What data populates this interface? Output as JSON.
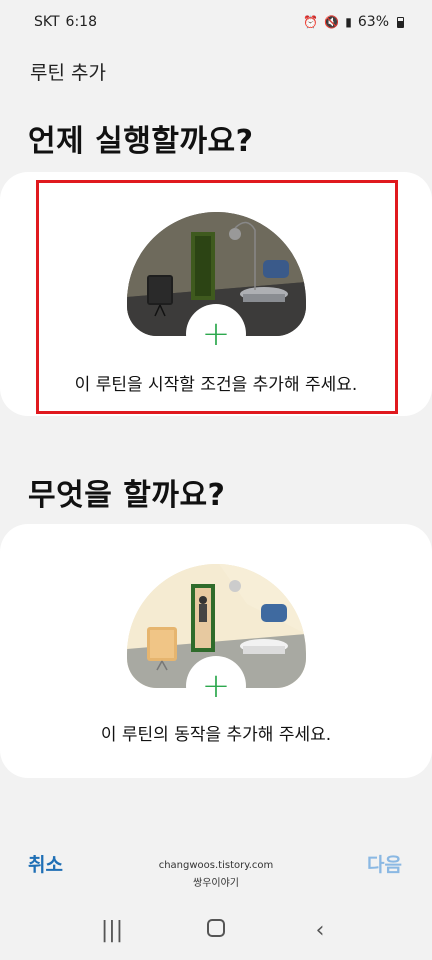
{
  "status_bar": {
    "carrier": "SKT",
    "time": "6:18",
    "battery": "63%",
    "icons": [
      "alarm-icon",
      "mute-icon",
      "volte-icon",
      "signal-icon",
      "battery-icon"
    ]
  },
  "screen_title": "루틴 추가",
  "when_section": {
    "heading": "언제 실행할까요?",
    "prompt": "이 루틴을 시작할 조건을 추가해 주세요.",
    "highlight_color": "#e0191e"
  },
  "what_section": {
    "heading": "무엇을 할까요?",
    "prompt": "이 루틴의 동작을 추가해 주세요."
  },
  "plus_symbol": "+",
  "actions": {
    "cancel": "취소",
    "next": "다음"
  },
  "watermark": {
    "line1": "changwoos.tistory.com",
    "line2": "쌍우이야기"
  },
  "colors": {
    "accent": "#1f6fb5",
    "disabled": "#8ab8e3",
    "plus": "#2da84e"
  }
}
